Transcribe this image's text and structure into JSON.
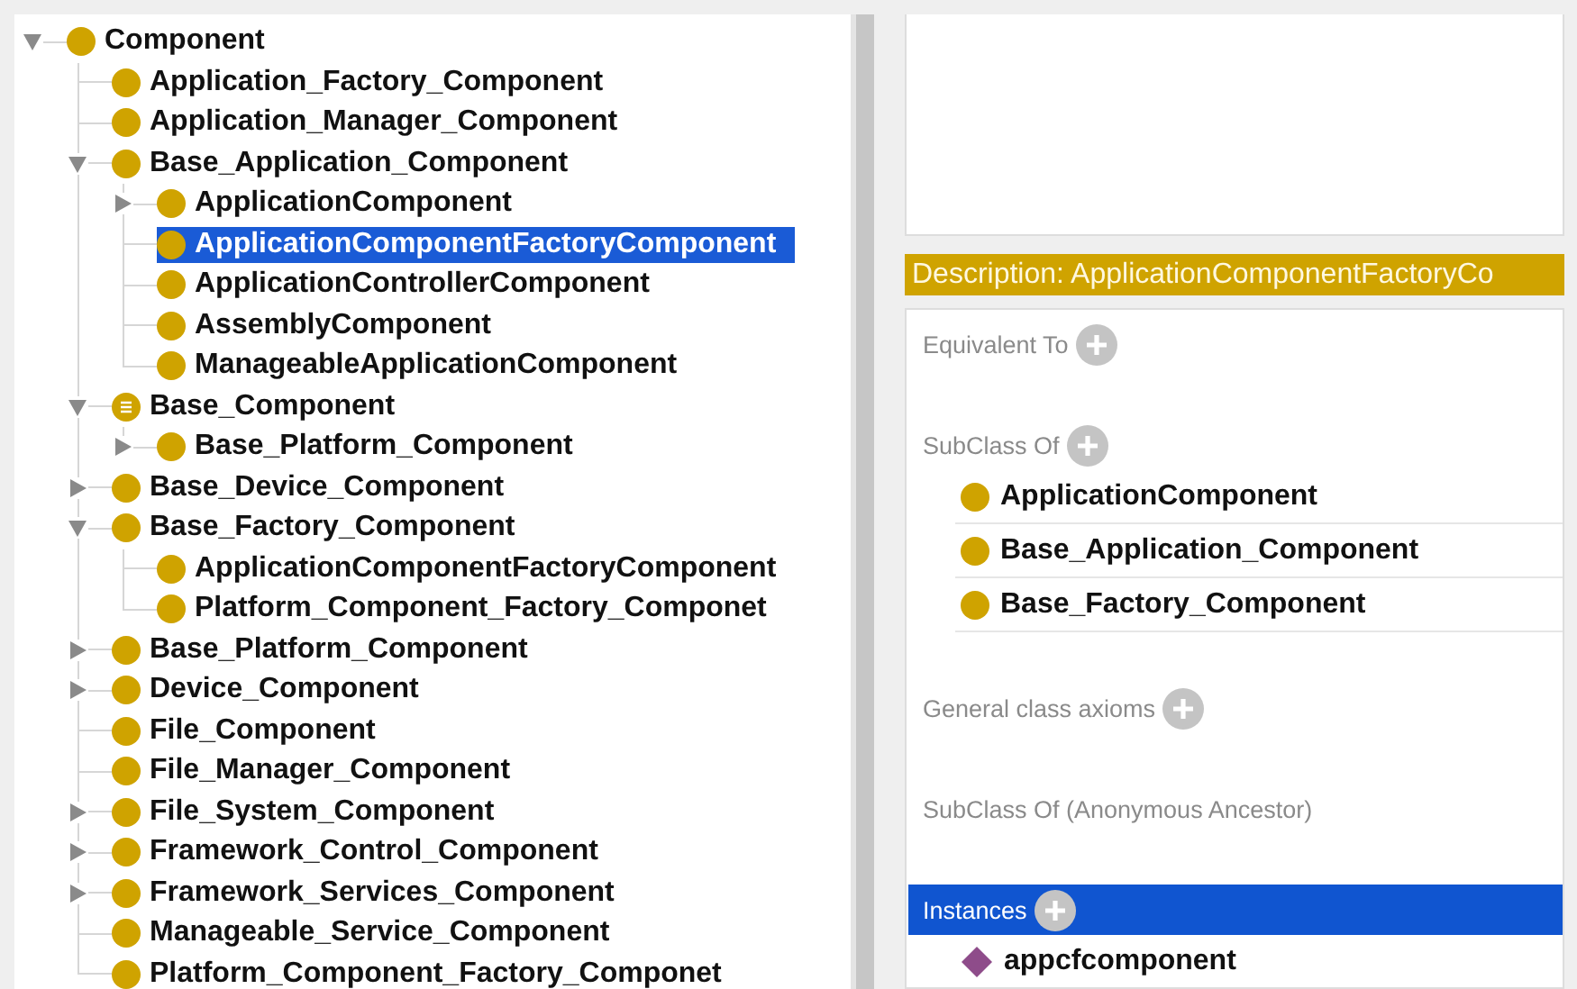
{
  "class_tree": {
    "nodes": [
      {
        "label": "Component",
        "defined": false,
        "selected": false,
        "kind": "expandable",
        "expanded": true,
        "children": [
          {
            "label": "Application_Factory_Component",
            "defined": false,
            "selected": false,
            "kind": "leaf"
          },
          {
            "label": "Application_Manager_Component",
            "defined": false,
            "selected": false,
            "kind": "leaf"
          },
          {
            "label": "Base_Application_Component",
            "defined": false,
            "selected": false,
            "kind": "expandable",
            "expanded": true,
            "children": [
              {
                "label": "ApplicationComponent",
                "defined": false,
                "selected": false,
                "kind": "expandable",
                "expanded": false
              },
              {
                "label": "ApplicationComponentFactoryComponent",
                "defined": false,
                "selected": true,
                "kind": "leaf"
              },
              {
                "label": "ApplicationControllerComponent",
                "defined": false,
                "selected": false,
                "kind": "leaf"
              },
              {
                "label": "AssemblyComponent",
                "defined": false,
                "selected": false,
                "kind": "leaf"
              },
              {
                "label": "ManageableApplicationComponent",
                "defined": false,
                "selected": false,
                "kind": "leaf"
              }
            ]
          },
          {
            "label": "Base_Component",
            "defined": true,
            "selected": false,
            "kind": "expandable",
            "expanded": true,
            "children": [
              {
                "label": "Base_Platform_Component",
                "defined": false,
                "selected": false,
                "kind": "expandable",
                "expanded": false
              }
            ]
          },
          {
            "label": "Base_Device_Component",
            "defined": false,
            "selected": false,
            "kind": "expandable",
            "expanded": false
          },
          {
            "label": "Base_Factory_Component",
            "defined": false,
            "selected": false,
            "kind": "expandable",
            "expanded": true,
            "children": [
              {
                "label": "ApplicationComponentFactoryComponent",
                "defined": false,
                "selected": false,
                "kind": "leaf"
              },
              {
                "label": "Platform_Component_Factory_Componet",
                "defined": false,
                "selected": false,
                "kind": "leaf"
              }
            ]
          },
          {
            "label": "Base_Platform_Component",
            "defined": false,
            "selected": false,
            "kind": "expandable",
            "expanded": false
          },
          {
            "label": "Device_Component",
            "defined": false,
            "selected": false,
            "kind": "expandable",
            "expanded": false
          },
          {
            "label": "File_Component",
            "defined": false,
            "selected": false,
            "kind": "leaf"
          },
          {
            "label": "File_Manager_Component",
            "defined": false,
            "selected": false,
            "kind": "leaf"
          },
          {
            "label": "File_System_Component",
            "defined": false,
            "selected": false,
            "kind": "expandable",
            "expanded": false
          },
          {
            "label": "Framework_Control_Component",
            "defined": false,
            "selected": false,
            "kind": "expandable",
            "expanded": false
          },
          {
            "label": "Framework_Services_Component",
            "defined": false,
            "selected": false,
            "kind": "expandable",
            "expanded": false
          },
          {
            "label": "Manageable_Service_Component",
            "defined": false,
            "selected": false,
            "kind": "leaf"
          },
          {
            "label": "Platform_Component_Factory_Componet",
            "defined": false,
            "selected": false,
            "kind": "leaf"
          }
        ]
      }
    ]
  },
  "description": {
    "title": "Description: ApplicationComponentFactoryCo",
    "sections": [
      {
        "label": "Equivalent To",
        "addable": true,
        "selected": false
      },
      {
        "label": "SubClass Of",
        "addable": true,
        "selected": false,
        "items": [
          {
            "label": "ApplicationComponent",
            "kind": "class"
          },
          {
            "label": "Base_Application_Component",
            "kind": "class"
          },
          {
            "label": "Base_Factory_Component",
            "kind": "class"
          }
        ]
      },
      {
        "label": "General class axioms",
        "addable": true,
        "selected": false
      },
      {
        "label": "SubClass Of (Anonymous Ancestor)",
        "addable": false,
        "selected": false
      },
      {
        "label": "Instances",
        "addable": true,
        "selected": true,
        "items": [
          {
            "label": "appcfcomponent",
            "kind": "individual"
          }
        ]
      }
    ]
  }
}
